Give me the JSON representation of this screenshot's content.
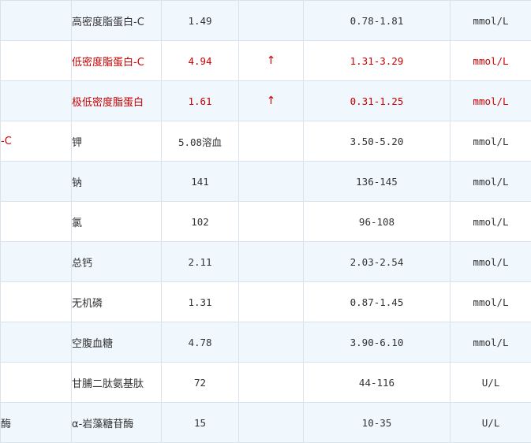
{
  "colors": {
    "abnormal_text": "#cc0000",
    "normal_text": "#333333",
    "stripe_background": "#f0f7fd",
    "border": "#d9e3ee"
  },
  "rows": [
    {
      "lead": "",
      "name": "高密度脂蛋白-C",
      "value": "1.49",
      "flag": "",
      "range": "0.78-1.81",
      "unit": "mmol/L",
      "abnormal": false
    },
    {
      "lead": "",
      "name": "低密度脂蛋白-C",
      "value": "4.94",
      "flag": "↑",
      "range": "1.31-3.29",
      "unit": "mmol/L",
      "abnormal": true
    },
    {
      "lead": "",
      "name": "极低密度脂蛋白",
      "value": "1.61",
      "flag": "↑",
      "range": "0.31-1.25",
      "unit": "mmol/L",
      "abnormal": true
    },
    {
      "lead": "-C",
      "name": "钾",
      "value": "5.08溶血",
      "flag": "",
      "range": "3.50-5.20",
      "unit": "mmol/L",
      "abnormal": false
    },
    {
      "lead": "",
      "name": "钠",
      "value": "141",
      "flag": "",
      "range": "136-145",
      "unit": "mmol/L",
      "abnormal": false
    },
    {
      "lead": "",
      "name": "氯",
      "value": "102",
      "flag": "",
      "range": "96-108",
      "unit": "mmol/L",
      "abnormal": false
    },
    {
      "lead": "",
      "name": "总钙",
      "value": "2.11",
      "flag": "",
      "range": "2.03-2.54",
      "unit": "mmol/L",
      "abnormal": false
    },
    {
      "lead": "",
      "name": "无机磷",
      "value": "1.31",
      "flag": "",
      "range": "0.87-1.45",
      "unit": "mmol/L",
      "abnormal": false
    },
    {
      "lead": "",
      "name": "空腹血糖",
      "value": "4.78",
      "flag": "",
      "range": "3.90-6.10",
      "unit": "mmol/L",
      "abnormal": false
    },
    {
      "lead": "",
      "name": "甘脯二肽氨基肽",
      "value": "72",
      "flag": "",
      "range": "44-116",
      "unit": "U/L",
      "abnormal": false
    },
    {
      "lead": "酶",
      "name": "α-岩藻糖苷酶",
      "value": "15",
      "flag": "",
      "range": "10-35",
      "unit": "U/L",
      "abnormal": false
    }
  ]
}
